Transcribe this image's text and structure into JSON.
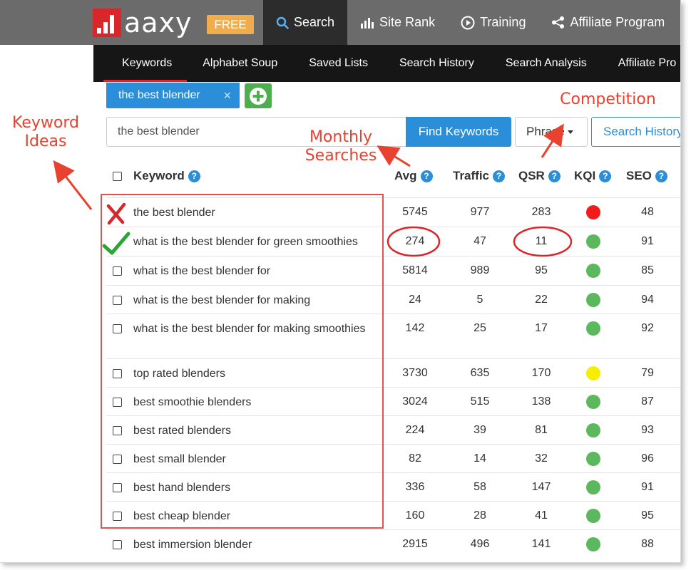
{
  "app": {
    "logo_text": "aaxy",
    "badge": "FREE"
  },
  "topnav": [
    {
      "label": "Search",
      "icon": "search-icon",
      "active": true
    },
    {
      "label": "Site Rank",
      "icon": "bar-chart-icon",
      "active": false
    },
    {
      "label": "Training",
      "icon": "play-circle-icon",
      "active": false
    },
    {
      "label": "Affiliate Program",
      "icon": "share-icon",
      "active": false
    }
  ],
  "subnav": [
    {
      "label": "Keywords",
      "active": true
    },
    {
      "label": "Alphabet Soup",
      "active": false
    },
    {
      "label": "Saved Lists",
      "active": false
    },
    {
      "label": "Search History",
      "active": false
    },
    {
      "label": "Search Analysis",
      "active": false
    },
    {
      "label": "Affiliate Pro",
      "active": false
    }
  ],
  "tag": {
    "label": "the best blender",
    "close": "×"
  },
  "search": {
    "value": "the best blender",
    "find_label": "Find Keywords",
    "phrase_label": "Phrase",
    "history_label": "Search History"
  },
  "table": {
    "headers": {
      "keyword": "Keyword",
      "avg": "Avg",
      "traffic": "Traffic",
      "qsr": "QSR",
      "kqi": "KQI",
      "seo": "SEO"
    },
    "help_glyph": "?",
    "rows": [
      {
        "keyword": "the best blender",
        "avg": "5745",
        "traffic": "977",
        "qsr": "283",
        "kqi": "red",
        "seo": "48"
      },
      {
        "keyword": "what is the best blender for green smoothies",
        "avg": "274",
        "traffic": "47",
        "qsr": "11",
        "kqi": "green",
        "seo": "91"
      },
      {
        "keyword": "what is the best blender for",
        "avg": "5814",
        "traffic": "989",
        "qsr": "95",
        "kqi": "green",
        "seo": "85"
      },
      {
        "keyword": "what is the best blender for making",
        "avg": "24",
        "traffic": "5",
        "qsr": "22",
        "kqi": "green",
        "seo": "94"
      },
      {
        "keyword": "what is the best blender for making smoothies",
        "avg": "142",
        "traffic": "25",
        "qsr": "17",
        "kqi": "green",
        "seo": "92"
      },
      {
        "keyword": "top rated blenders",
        "avg": "3730",
        "traffic": "635",
        "qsr": "170",
        "kqi": "yellow",
        "seo": "79"
      },
      {
        "keyword": "best smoothie blenders",
        "avg": "3024",
        "traffic": "515",
        "qsr": "138",
        "kqi": "green",
        "seo": "87"
      },
      {
        "keyword": "best rated blenders",
        "avg": "224",
        "traffic": "39",
        "qsr": "81",
        "kqi": "green",
        "seo": "93"
      },
      {
        "keyword": "best small blender",
        "avg": "82",
        "traffic": "14",
        "qsr": "32",
        "kqi": "green",
        "seo": "96"
      },
      {
        "keyword": "best hand blenders",
        "avg": "336",
        "traffic": "58",
        "qsr": "147",
        "kqi": "green",
        "seo": "91"
      },
      {
        "keyword": "best cheap blender",
        "avg": "160",
        "traffic": "28",
        "qsr": "41",
        "kqi": "green",
        "seo": "95"
      },
      {
        "keyword": "best immersion blender",
        "avg": "2915",
        "traffic": "496",
        "qsr": "141",
        "kqi": "green",
        "seo": "88"
      }
    ]
  },
  "annotations": {
    "keyword_ideas": "Keyword Ideas",
    "monthly_searches": "Monthly Searches",
    "competition": "Competition"
  },
  "colors": {
    "brand_red": "#d9262a",
    "accent_blue": "#2a8fd8",
    "badge_orange": "#f0ad4e",
    "add_green": "#4cae4c",
    "kqi_red": "#ee1c1c",
    "kqi_green": "#5cb85c",
    "kqi_yellow": "#f5ee00",
    "annotation_red": "#e8412f"
  }
}
